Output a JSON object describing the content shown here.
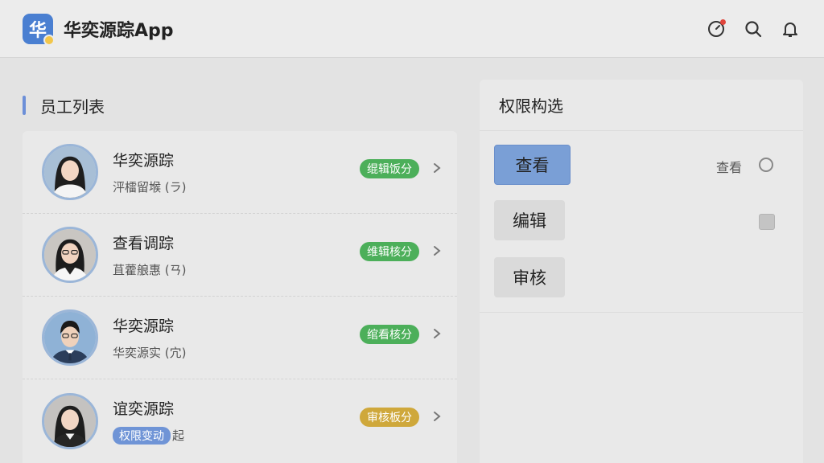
{
  "app": {
    "title": "华奕源踪App",
    "logo_char": "华"
  },
  "header_icons": [
    "target-icon",
    "search-icon",
    "bell-icon"
  ],
  "employees": {
    "title": "员工列表",
    "items": [
      {
        "name": "华奕源踪",
        "subtitle": "泙檑留堠 (ラ)",
        "status": "绲辑饭分",
        "status_color": "#4caf5a"
      },
      {
        "name": "查看调踪",
        "subtitle": "苴藿艆惠 (ㄢ)",
        "status": "维辑核分",
        "status_color": "#4caf5a"
      },
      {
        "name": "华奕源踪",
        "subtitle": "华奕源实 (宂)",
        "status": "绾看核分",
        "status_color": "#4caf5a"
      },
      {
        "name": "谊奕源踪",
        "subtitle_badge": "权限变动",
        "subtitle": "起",
        "status": "审核板分",
        "status_color": "#cfa83b"
      }
    ]
  },
  "permissions": {
    "title": "权限构选",
    "options": [
      "查看",
      "编辑",
      "审核"
    ],
    "view_label": "查看"
  },
  "colors": {
    "accent": "#6f94d6",
    "status_green": "#4caf5a",
    "status_gold": "#cfa83b",
    "notify_dot": "#e0453c"
  }
}
